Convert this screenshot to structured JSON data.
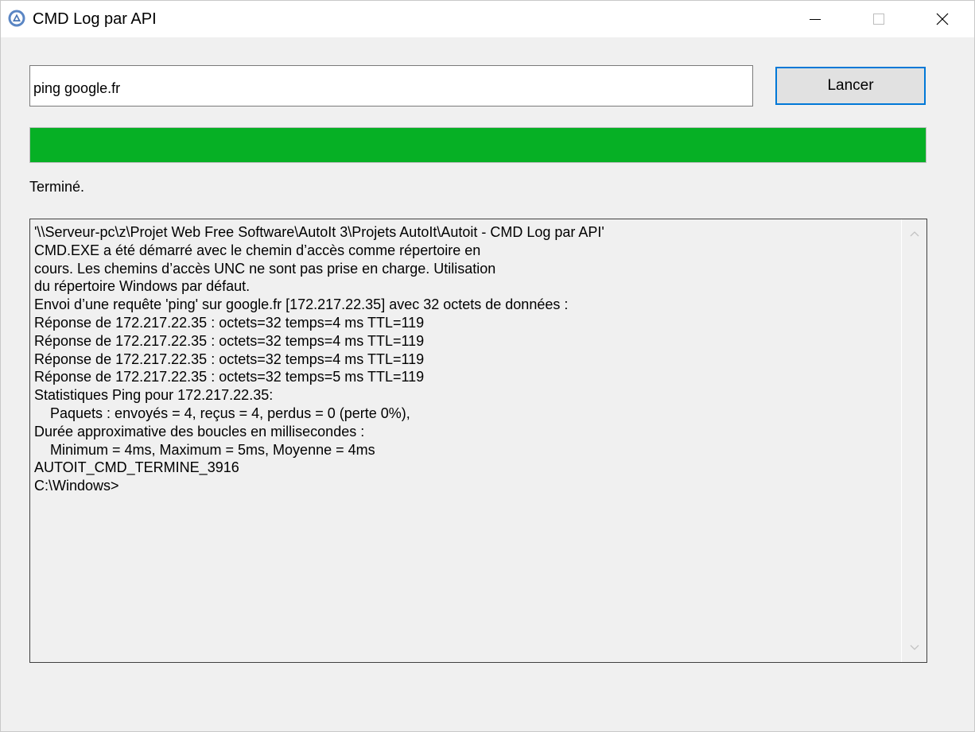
{
  "window": {
    "title": "CMD Log par API",
    "icon": "autoit-app-icon"
  },
  "command": {
    "value": "ping google.fr"
  },
  "launch_button": {
    "label": "Lancer"
  },
  "progress": {
    "percent": 100,
    "color": "#06b025"
  },
  "status": {
    "text": "Terminé."
  },
  "log": {
    "lines": [
      "'\\\\Serveur-pc\\z\\Projet Web Free Software\\AutoIt 3\\Projets AutoIt\\Autoit - CMD Log par API'",
      "CMD.EXE a été démarré avec le chemin d’accès comme répertoire en",
      "cours. Les chemins d’accès UNC ne sont pas prise en charge. Utilisation",
      "du répertoire Windows par défaut.",
      "Envoi d’une requête 'ping' sur google.fr [172.217.22.35] avec 32 octets de données :",
      "Réponse de 172.217.22.35 : octets=32 temps=4 ms TTL=119",
      "Réponse de 172.217.22.35 : octets=32 temps=4 ms TTL=119",
      "Réponse de 172.217.22.35 : octets=32 temps=4 ms TTL=119",
      "Réponse de 172.217.22.35 : octets=32 temps=5 ms TTL=119",
      "Statistiques Ping pour 172.217.22.35:",
      "    Paquets : envoyés = 4, reçus = 4, perdus = 0 (perte 0%),",
      "Durée approximative des boucles en millisecondes :",
      "    Minimum = 4ms, Maximum = 5ms, Moyenne = 4ms",
      "AUTOIT_CMD_TERMINE_3916",
      "C:\\Windows>"
    ]
  }
}
